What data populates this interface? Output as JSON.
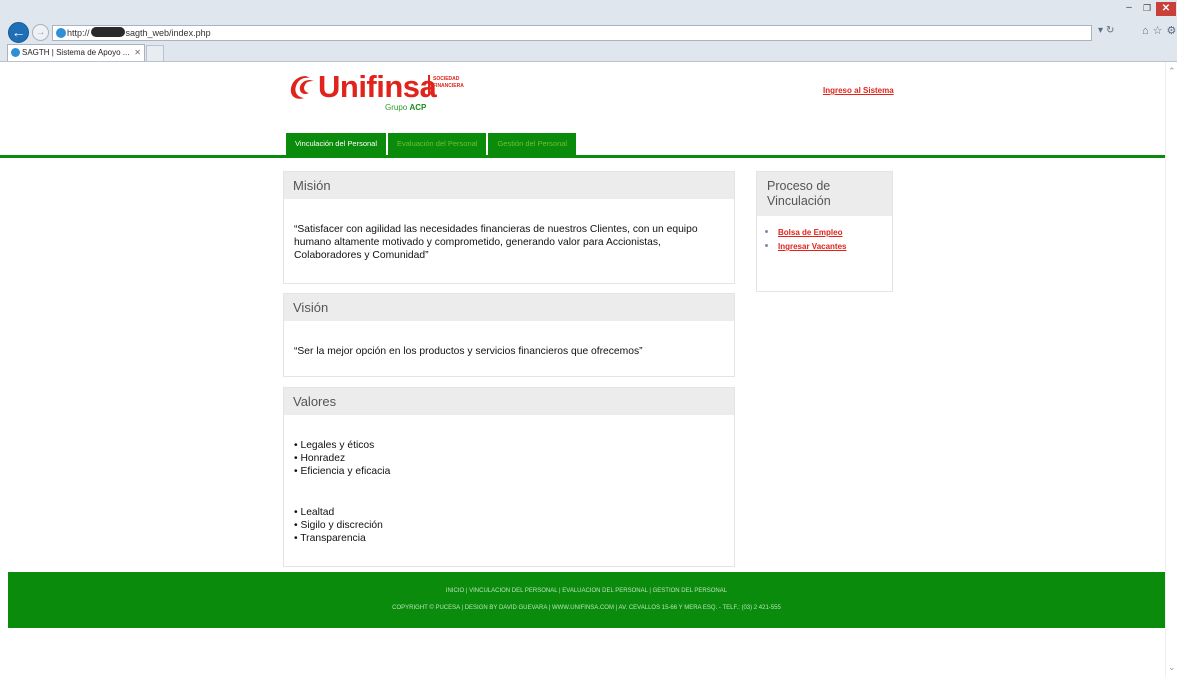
{
  "browser": {
    "url_prefix": "http://",
    "url_suffix": "sagth_web/index.php",
    "tab_title": "SAGTH | Sistema de Apoyo ...",
    "window_controls": {
      "minimize": "–",
      "maximize": "❐",
      "close": "✕"
    }
  },
  "header": {
    "logo_text": "Unifinsa",
    "logo_sub": "SOCIEDAD FINANCIERA",
    "logo_group_prefix": "Grupo",
    "logo_group_name": "ACP",
    "login_link": "Ingreso al Sistema"
  },
  "menu": [
    {
      "label": "Vinculación del Personal",
      "active": true
    },
    {
      "label": "Evaluación del Personal",
      "active": false
    },
    {
      "label": "Gestión del Personal",
      "active": false
    }
  ],
  "mision": {
    "title": "Misión",
    "text": "“Satisfacer con agilidad las necesidades financieras de nuestros Clientes, con un equipo humano altamente motivado y comprometido, generando valor para Accionistas, Colaboradores y Comunidad”"
  },
  "vision": {
    "title": "Visión",
    "text": "“Ser la mejor opción en los productos y servicios financieros que ofrecemos”"
  },
  "valores": {
    "title": "Valores",
    "group1": [
      "• Legales y éticos",
      "• Honradez",
      "• Eficiencia y eficacia"
    ],
    "group2": [
      "• Lealtad",
      "• Sigilo y discreción",
      "• Transparencia"
    ]
  },
  "sidebar": {
    "title": "Proceso de Vinculación",
    "links": [
      "Bolsa de Empleo",
      "Ingresar Vacantes"
    ]
  },
  "footer": {
    "nav": "INICIO | VINCULACION DEL PERSONAL | EVALUACION DEL PERSONAL | GESTION DEL PERSONAL",
    "copyright": "COPYRIGHT © PUCESA | DESIGN BY DAVID GUEVARA | WWW.UNIFINSA.COM | AV. CEVALLOS 15-66 Y MERA ESQ. - TELF.: (03) 2 421-555"
  },
  "colors": {
    "brand_red": "#e0231b",
    "brand_green": "#0b8b0b"
  }
}
